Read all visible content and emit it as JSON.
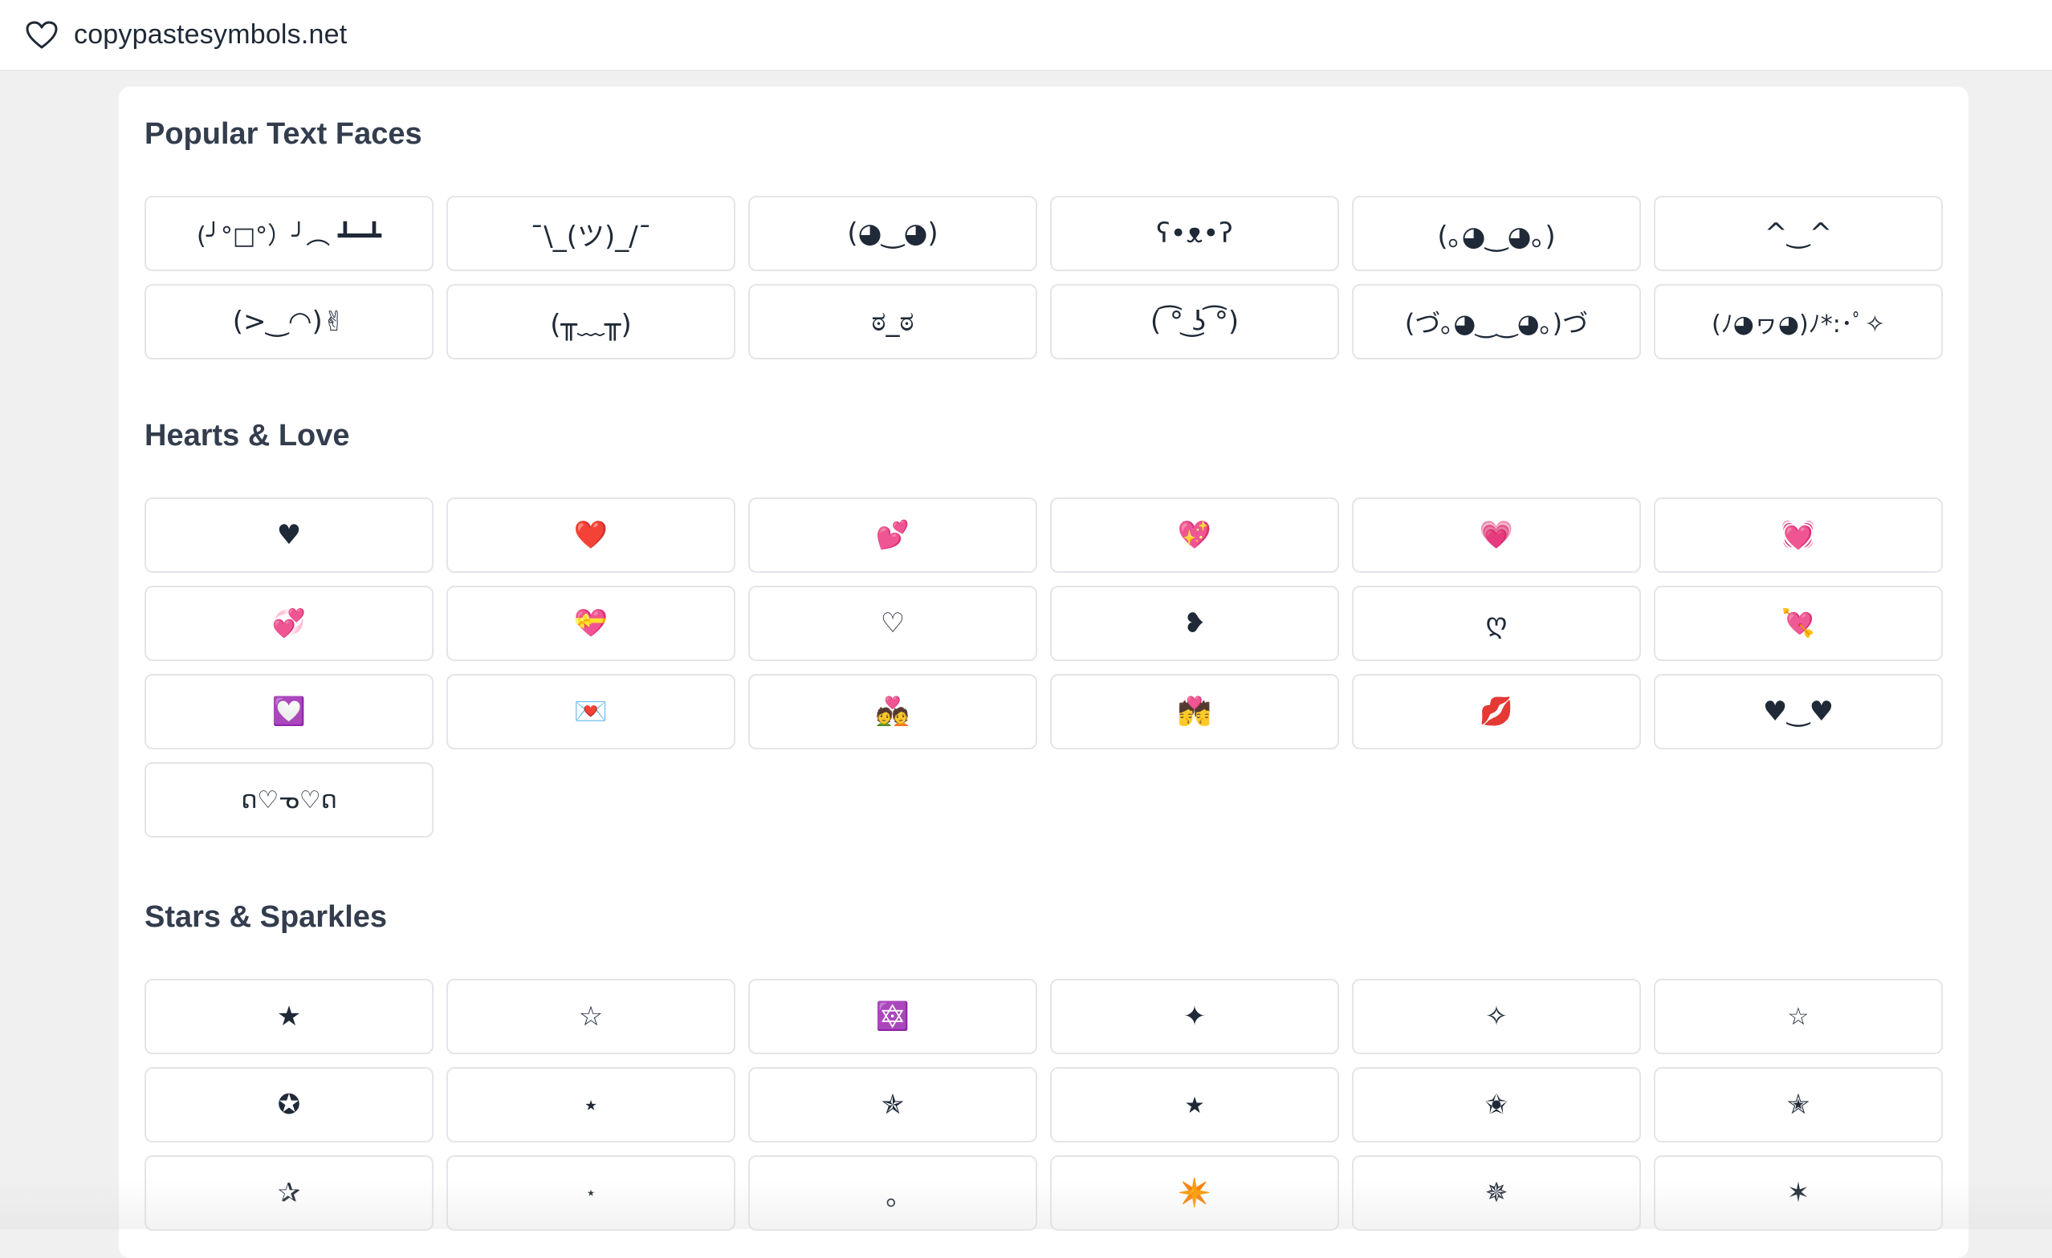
{
  "header": {
    "site_name": "copypastesymbols.net",
    "logo_icon": "heart-outline-icon"
  },
  "sections": [
    {
      "title": "Popular Text Faces",
      "symbols": [
        "(╯°□°）╯︵ ┻━┻",
        "¯\\_(ツ)_/¯",
        "(◕‿◕)",
        "ʕ•ᴥ•ʔ",
        "(｡◕‿◕｡)",
        "^‿^",
        "(>‿◠)✌",
        "(╥﹏╥)",
        "ಠ_ಠ",
        "( ͡° ͜ʖ ͡°)",
        "(づ｡◕‿‿◕｡)づ",
        "(ﾉ◕ヮ◕)ﾉ*:･ﾟ✧"
      ]
    },
    {
      "title": "Hearts & Love",
      "symbols": [
        "♥",
        "❤️",
        "💕",
        "💖",
        "💗",
        "💓",
        "💞",
        "💝",
        "♡",
        "❥",
        "ღ",
        "💘",
        "💟",
        "💌",
        "💑",
        "💏",
        "💋",
        "♥‿♥",
        "ດ♡ᓀ♡ດ"
      ]
    },
    {
      "title": "Stars & Sparkles",
      "symbols": [
        "★",
        "☆",
        "🔯",
        "✦",
        "✧",
        "☆",
        "✪",
        "⭑",
        "✯",
        "★",
        "✬",
        "✭",
        "✰",
        "⋆",
        "｡",
        "✴️",
        "✵",
        "✶"
      ]
    }
  ]
}
